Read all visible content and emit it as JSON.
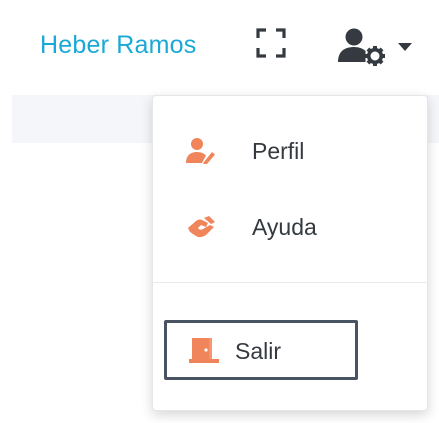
{
  "navbar": {
    "user_name": "Heber Ramos",
    "fullscreen_icon": "expand-icon",
    "user_menu_icon": "user-cog-icon",
    "caret_icon": "caret-down-icon"
  },
  "dropdown": {
    "items": [
      {
        "label": "Perfil",
        "icon": "user-edit-icon"
      },
      {
        "label": "Ayuda",
        "icon": "hands-helping-icon"
      }
    ],
    "logout": {
      "label": "Salir",
      "icon": "door-open-icon"
    }
  },
  "colors": {
    "accent": "#1aa9d6",
    "icon_orange": "#f0845a",
    "text": "#343a40",
    "focus_border": "#4a5361",
    "icon_dark": "#343a40"
  }
}
